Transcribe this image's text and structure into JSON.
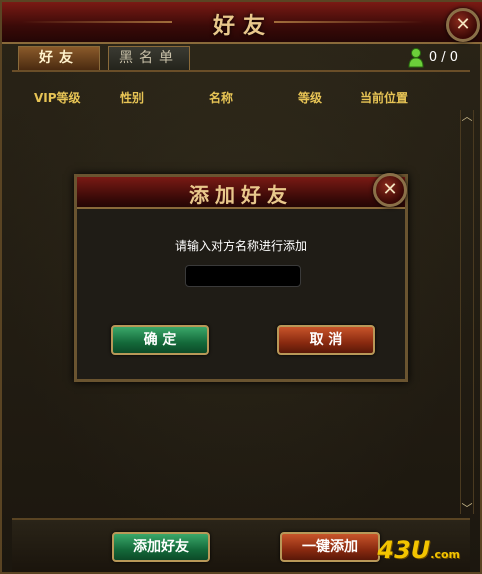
{
  "window": {
    "title": "好友",
    "close_label": "✕"
  },
  "tabs": [
    {
      "label": "好友",
      "active": true
    },
    {
      "label": "黑名单",
      "active": false
    }
  ],
  "friend_count": "0 / 0",
  "columns": [
    "VIP等级",
    "性别",
    "名称",
    "等级",
    "当前位置"
  ],
  "scrollbar": {
    "up": "︿",
    "down": "﹀"
  },
  "bottom_buttons": {
    "add_friend": "添加好友",
    "one_click_add": "一键添加"
  },
  "watermark": {
    "main": "43U",
    "suffix": ".com"
  },
  "dialog": {
    "title": "添加好友",
    "close_label": "✕",
    "prompt": "请输入对方名称进行添加",
    "input_value": "",
    "input_placeholder": "",
    "confirm_label": "确 定",
    "cancel_label": "取 消"
  },
  "colors": {
    "title_red": "#5a100c",
    "gold_text": "#e7c455",
    "green_button": "#146a3a",
    "red_button": "#8a2a10"
  }
}
